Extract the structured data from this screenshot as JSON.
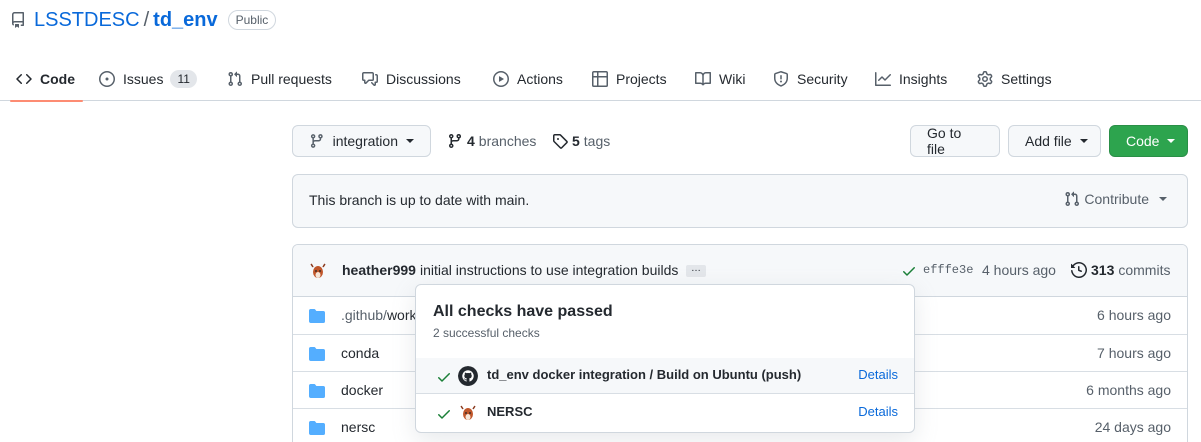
{
  "repo": {
    "owner": "LSSTDESC",
    "separator": "/",
    "name": "td_env",
    "visibility": "Public",
    "icon": "repo-icon"
  },
  "tabs": [
    {
      "label": "Code",
      "icon": "code-icon",
      "selected": true
    },
    {
      "label": "Issues",
      "icon": "issue-icon",
      "count": "11"
    },
    {
      "label": "Pull requests",
      "icon": "pull-request-icon"
    },
    {
      "label": "Discussions",
      "icon": "discussions-icon"
    },
    {
      "label": "Actions",
      "icon": "play-icon"
    },
    {
      "label": "Projects",
      "icon": "table-icon"
    },
    {
      "label": "Wiki",
      "icon": "book-icon"
    },
    {
      "label": "Security",
      "icon": "shield-icon"
    },
    {
      "label": "Insights",
      "icon": "graph-icon"
    },
    {
      "label": "Settings",
      "icon": "gear-icon"
    }
  ],
  "toolbar": {
    "branch": "integration",
    "branches_count": "4",
    "branches_label": "branches",
    "tags_count": "5",
    "tags_label": "tags",
    "go_to_file": "Go to file",
    "add_file": "Add file",
    "code": "Code"
  },
  "branch_status": {
    "message": "This branch is up to date with main.",
    "contribute": "Contribute"
  },
  "latest_commit": {
    "author": "heather999",
    "message": "initial instructions to use integration builds",
    "more": "…",
    "sha": "efffe3e",
    "time": "4 hours ago",
    "commits_count": "313",
    "commits_label": "commits"
  },
  "files": [
    {
      "name_dim": ".github/",
      "name": "workflows",
      "age": "6 hours ago"
    },
    {
      "name_dim": "",
      "name": "conda",
      "age": "7 hours ago"
    },
    {
      "name_dim": "",
      "name": "docker",
      "age": "6 months ago"
    },
    {
      "name_dim": "",
      "name": "nersc",
      "age": "24 days ago"
    }
  ],
  "checks_popover": {
    "title": "All checks have passed",
    "subtitle": "2 successful checks",
    "checks": [
      {
        "name": "td_env docker integration / Build on Ubuntu (push)",
        "link": "Details",
        "logo": "github-logo-icon"
      },
      {
        "name": "NERSC",
        "link": "Details",
        "logo": "nersc-avatar-icon"
      }
    ]
  },
  "colors": {
    "link": "#0969da",
    "accent_underline": "#fd8c73",
    "success": "#1a7f37",
    "primary_button": "#2da44e",
    "folder": "#54aeff"
  }
}
